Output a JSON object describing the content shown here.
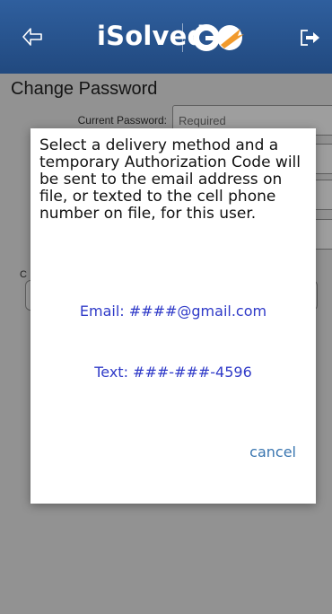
{
  "header": {
    "brand_text": "iSolved",
    "brand_badge": "GO"
  },
  "page": {
    "title": "Change Password",
    "current_password_label": "Current Password:",
    "current_password_placeholder": "Required",
    "partial_label": "C"
  },
  "modal": {
    "message": "Select a delivery method and a temporary Authorization Code will be sent to the email address on file, or texted to the cell phone number on file, for this user.",
    "email_option": "Email: ####@gmail.com",
    "text_option": "Text: ###-###-4596",
    "cancel_label": "cancel"
  },
  "colors": {
    "header_blue": "#2a5590",
    "link_blue": "#2f3ac8",
    "cancel_blue": "#3a76b0",
    "go_orange": "#f19a2c"
  }
}
